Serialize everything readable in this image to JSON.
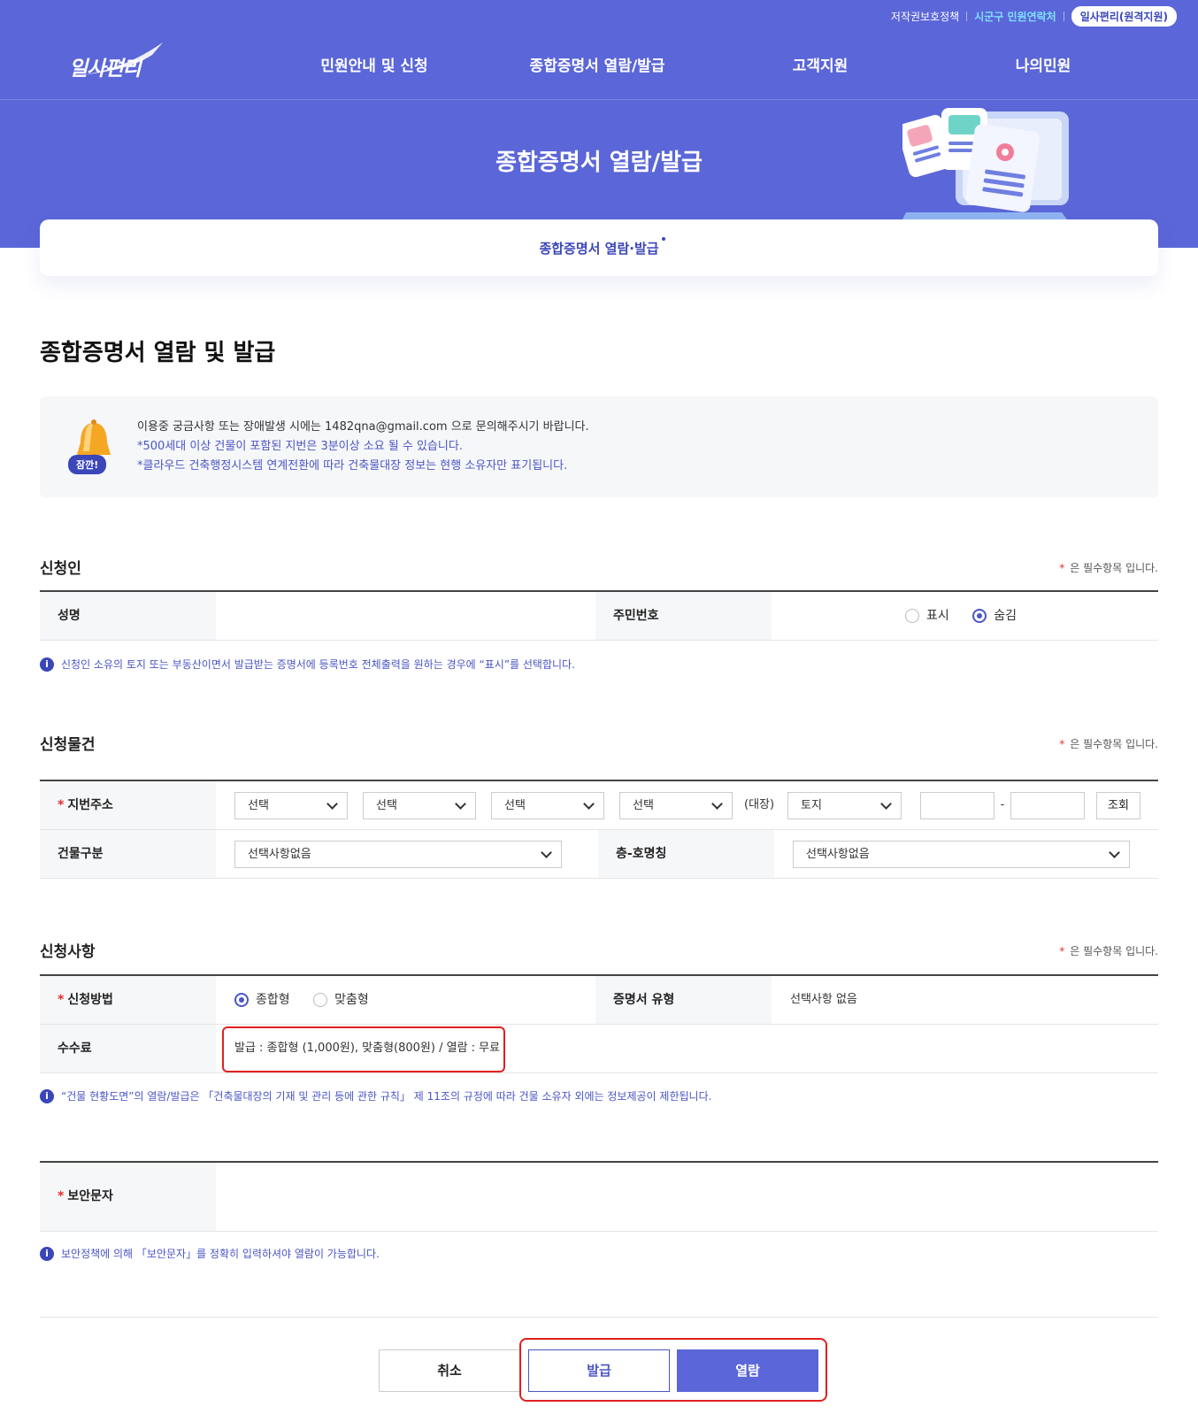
{
  "header": {
    "util_links": [
      "저작권보호정책",
      "시군구 민원연락처",
      "일사편리(원격지원)"
    ],
    "logo_text": "일사편리",
    "nav": [
      "민원안내 및 신청",
      "종합증명서 열람/발급",
      "고객지원",
      "나의민원"
    ],
    "hero_title": "종합증명서 열람/발급",
    "tab": "종합증명서 열람·발급"
  },
  "page_title": "종합증명서 열람 및 발급",
  "notice": {
    "badge": "잠깐!",
    "lines": [
      "이용중 궁금사항 또는 장애발생 시에는 1482qna@gmail.com 으로 문의해주시기 바랍니다.",
      "*500세대 이상 건물이 포함된 지번은 3분이상 소요 될 수 있습니다.",
      "*클라우드 건축행정시스템 연계전환에 따라 건축물대장 정보는 현행 소유자만 표기됩니다."
    ]
  },
  "required_note": "은 필수항목 입니다.",
  "applicant": {
    "title": "신청인",
    "name_label": "성명",
    "rrn_label": "주민번호",
    "rrn_options": [
      "표시",
      "숨김"
    ],
    "rrn_selected": "숨김",
    "info": "신청인 소유의 토지 또는 부동산이면서 발급받는 증명서에 등록번호 전체출력을 원하는 경우에 “표시”를 선택합니다."
  },
  "property": {
    "title": "신청물건",
    "address_label": "지번주소",
    "selects": [
      "선택",
      "선택",
      "선택",
      "선택"
    ],
    "daejang_label": "(대장)",
    "land_type": "토지",
    "dash": "-",
    "search_button": "조회",
    "building_label": "건물구분",
    "building_value": "선택사항없음",
    "floor_label": "층-호명칭",
    "floor_value": "선택사항없음"
  },
  "request": {
    "title": "신청사항",
    "method_label": "신청방법",
    "method_options": [
      "종합형",
      "맞춤형"
    ],
    "method_selected": "종합형",
    "cert_type_label": "증명서 유형",
    "cert_type_value": "선택사항 없음",
    "fee_label": "수수료",
    "fee_value": "발급 : 종합형 (1,000원), 맞춤형(800원) / 열람 : 무료",
    "info": "“건물 현황도면”의 열람/발급은 「건축물대장의 기재 및 관리 등에 관한 규칙」 제 11조의 규정에 따라 건물 소유자 외에는 정보제공이 제한됩니다."
  },
  "security": {
    "label": "보안문자",
    "info": "보안정책에 의해 「보안문자」를 정확히 입력하셔야 열람이 가능합니다."
  },
  "buttons": {
    "cancel": "취소",
    "issue": "발급",
    "view": "열람"
  },
  "colors": {
    "primary": "#5b66d8",
    "accent": "#4a55c4",
    "required": "#e03030",
    "highlight": "#e02020"
  }
}
